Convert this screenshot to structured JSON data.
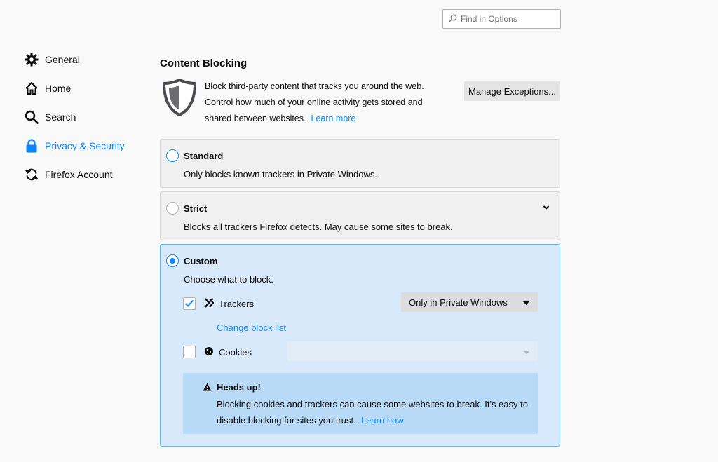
{
  "search": {
    "placeholder": "Find in Options"
  },
  "sidebar": {
    "items": [
      {
        "label": "General",
        "icon": "gear-icon"
      },
      {
        "label": "Home",
        "icon": "home-icon"
      },
      {
        "label": "Search",
        "icon": "search-icon"
      },
      {
        "label": "Privacy & Security",
        "icon": "lock-icon",
        "active": true
      },
      {
        "label": "Firefox Account",
        "icon": "sync-icon"
      }
    ]
  },
  "content_blocking": {
    "title": "Content Blocking",
    "description": "Block third-party content that tracks you around the web. Control how much of your online activity gets stored and shared between websites.",
    "learn_more": "Learn more",
    "manage_exceptions": "Manage Exceptions...",
    "options": {
      "standard": {
        "title": "Standard",
        "description": "Only blocks known trackers in Private Windows."
      },
      "strict": {
        "title": "Strict",
        "description": "Blocks all trackers Firefox detects. May cause some sites to break."
      },
      "custom": {
        "title": "Custom",
        "description": "Choose what to block.",
        "selected": true
      }
    },
    "trackers": {
      "label": "Trackers",
      "checked": true,
      "select_value": "Only in Private Windows",
      "change_block_list": "Change block list"
    },
    "cookies": {
      "label": "Cookies",
      "checked": false,
      "select_value": ""
    },
    "heads_up": {
      "title": "Heads up!",
      "text": "Blocking cookies and trackers can cause some websites to break. It's easy to disable blocking for sites you trust.",
      "learn_how": "Learn how"
    }
  },
  "colors": {
    "accent": "#0a84ff",
    "selected_card": "#d8e9fc",
    "headsup_bg": "#b8daf7"
  }
}
